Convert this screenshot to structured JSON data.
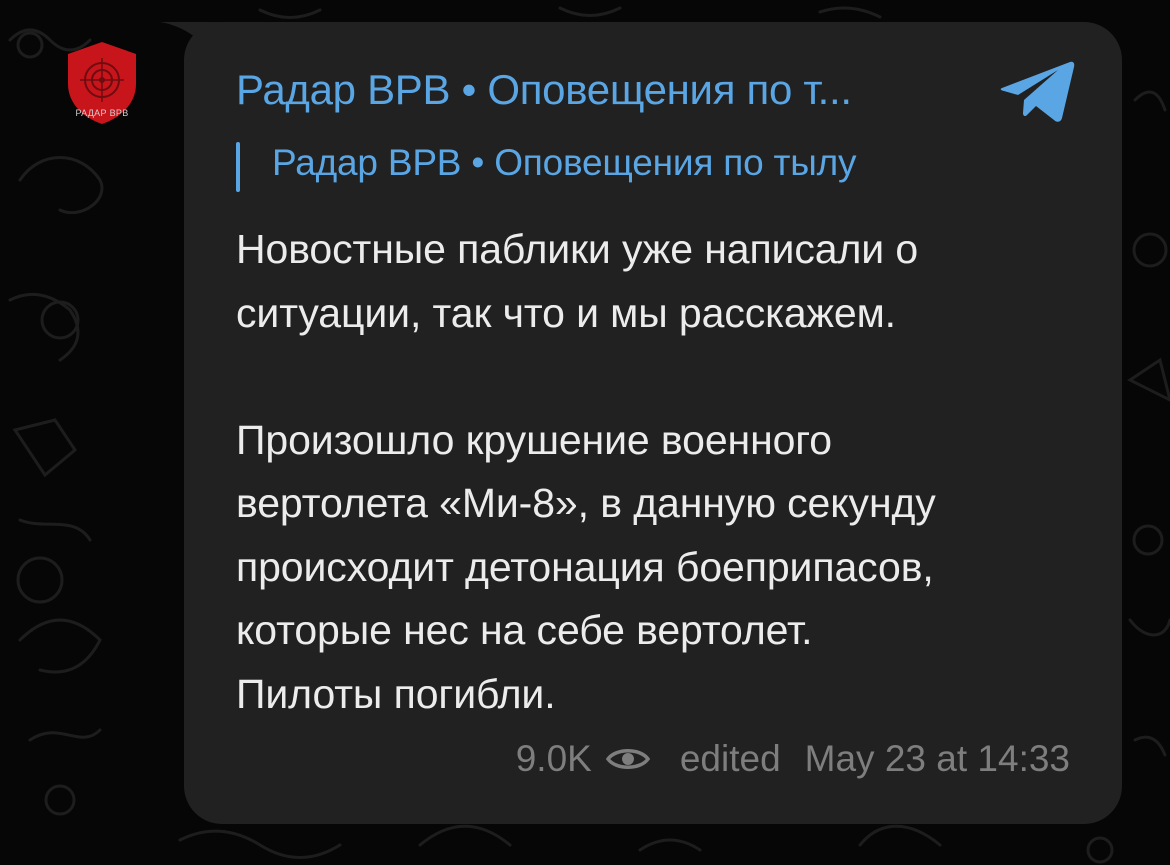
{
  "channel": {
    "avatar_label": "РАДАР ВРВ",
    "header_title": "Радар ВРВ • Оповещения по т...",
    "forward_title": "Радар ВРВ • Оповещения по тылу"
  },
  "message": {
    "text": "Новостные паблики уже написали о\nситуации, так что и мы расскажем.\n\nПроизошло крушение военного\nвертолета «Ми-8», в данную секунду\nпроисходит детонация боеприпасов,\nкоторые нес на себе вертолет.\nПилоты погибли.",
    "views": "9.0K",
    "edited_label": "edited",
    "timestamp": "May 23 at 14:33"
  },
  "icons": {
    "share": "telegram-plane-icon",
    "views": "eye-icon",
    "avatar": "shield-icon"
  },
  "colors": {
    "background": "#060606",
    "bubble": "#212121",
    "accent": "#5aa6e5",
    "text": "#ececec",
    "meta": "#7e7e7e",
    "avatar_red": "#c8151b"
  }
}
